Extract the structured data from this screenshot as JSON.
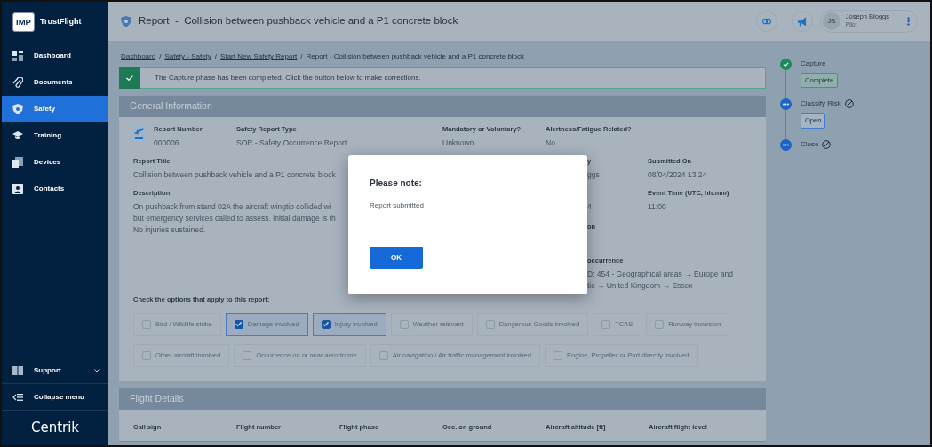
{
  "brand": {
    "logo": "IMP",
    "name": "TrustFlight"
  },
  "sidebar": {
    "items": [
      {
        "label": "Dashboard",
        "selected": false
      },
      {
        "label": "Documents",
        "selected": false
      },
      {
        "label": "Safety",
        "selected": true
      },
      {
        "label": "Training",
        "selected": false
      },
      {
        "label": "Devices",
        "selected": false
      },
      {
        "label": "Contacts",
        "selected": false
      }
    ],
    "footer": [
      {
        "label": "Support",
        "expandable": true
      },
      {
        "label": "Collapse menu",
        "expandable": false
      }
    ],
    "footer_logo": "Centrik"
  },
  "header": {
    "title": "Report  -  Collision between pushback vehicle and a P1 concrete block",
    "user": {
      "initials": "JB",
      "name": "Joseph Bloggs",
      "role": "Pilot"
    }
  },
  "breadcrumbs": [
    {
      "label": "Dashboard",
      "link": true
    },
    {
      "separator": "/",
      "label": "Safety - Safety",
      "link": true
    },
    {
      "separator": "/",
      "label": "Start New Safety Report",
      "link": true
    },
    {
      "separator": "/",
      "label": "Report - Collision between pushback vehicle and a P1 concrete block",
      "link": false
    }
  ],
  "alert": "The Capture phase has been completed. Click the button below to make corrections.",
  "general": {
    "title": "General Information",
    "report_number": {
      "label": "Report Number",
      "value": "000006"
    },
    "fields_row1": [
      {
        "label": "Safety Report Type",
        "value": "SOR - Safety Occurrence Report"
      },
      {
        "label": "Mandatory or Voluntary?",
        "value": "Unknown"
      },
      {
        "label": "Alertness/Fatigue Related?",
        "value": "No"
      }
    ],
    "report_title": {
      "label": "Report Title",
      "value": "Collision between pushback vehicle and a P1 concrete block"
    },
    "description": {
      "label": "Description",
      "lines": [
        "On pushback from stand 02A the aircraft wingtip collided wi",
        "but emergency services called to assess. initial damage is th",
        "No injuries sustained."
      ]
    },
    "partial": {
      "reporter_label": "y",
      "reporter_value": "ggs",
      "event_date_value": "4",
      "location_label": "on",
      "occurrence_label": "occurrence",
      "occurrence_lines": [
        "D: 454 - Geographical areas → Europe and",
        "tic → United Kingdom → Essex"
      ]
    },
    "submitted": {
      "label": "Submitted On",
      "value": "08/04/2024 13:24"
    },
    "event_time": {
      "label": "Event Time (UTC, hh:mm)",
      "value": "11:00"
    },
    "options_label": "Check the options that apply to this report:",
    "options": [
      [
        {
          "label": "Bird / Wildlife strike",
          "checked": false
        },
        {
          "label": "Damage involved",
          "checked": true
        },
        {
          "label": "Injury involved",
          "checked": true
        },
        {
          "label": "Weather relevant",
          "checked": false
        },
        {
          "label": "Dangerous Goods involved",
          "checked": false
        },
        {
          "label": "TCAS",
          "checked": false
        },
        {
          "label": "Runway incursion",
          "checked": false
        }
      ],
      [
        {
          "label": "Other aircraft involved",
          "checked": false
        },
        {
          "label": "Occurrence on or near aerodrome",
          "checked": false
        },
        {
          "label": "Air navigation / Air traffic management involved",
          "checked": false
        },
        {
          "label": "Engine, Propeller or Part directly involved",
          "checked": false
        }
      ]
    ]
  },
  "flight_details": {
    "title": "Flight Details",
    "columns": [
      "Call sign",
      "Flight number",
      "Flight phase",
      "Occ. on ground",
      "Aircraft altitude [ft]",
      "Aircraft flight level"
    ]
  },
  "timeline": [
    {
      "label": "Capture",
      "kind": "done",
      "badge": "Complete",
      "blocked": false
    },
    {
      "label": "Classify Risk",
      "kind": "pending",
      "badge": "Open",
      "blocked": true
    },
    {
      "label": "Close",
      "kind": "pending",
      "blocked": true
    }
  ],
  "modal": {
    "title": "Please note:",
    "message": "Report submitted",
    "button": "OK"
  }
}
